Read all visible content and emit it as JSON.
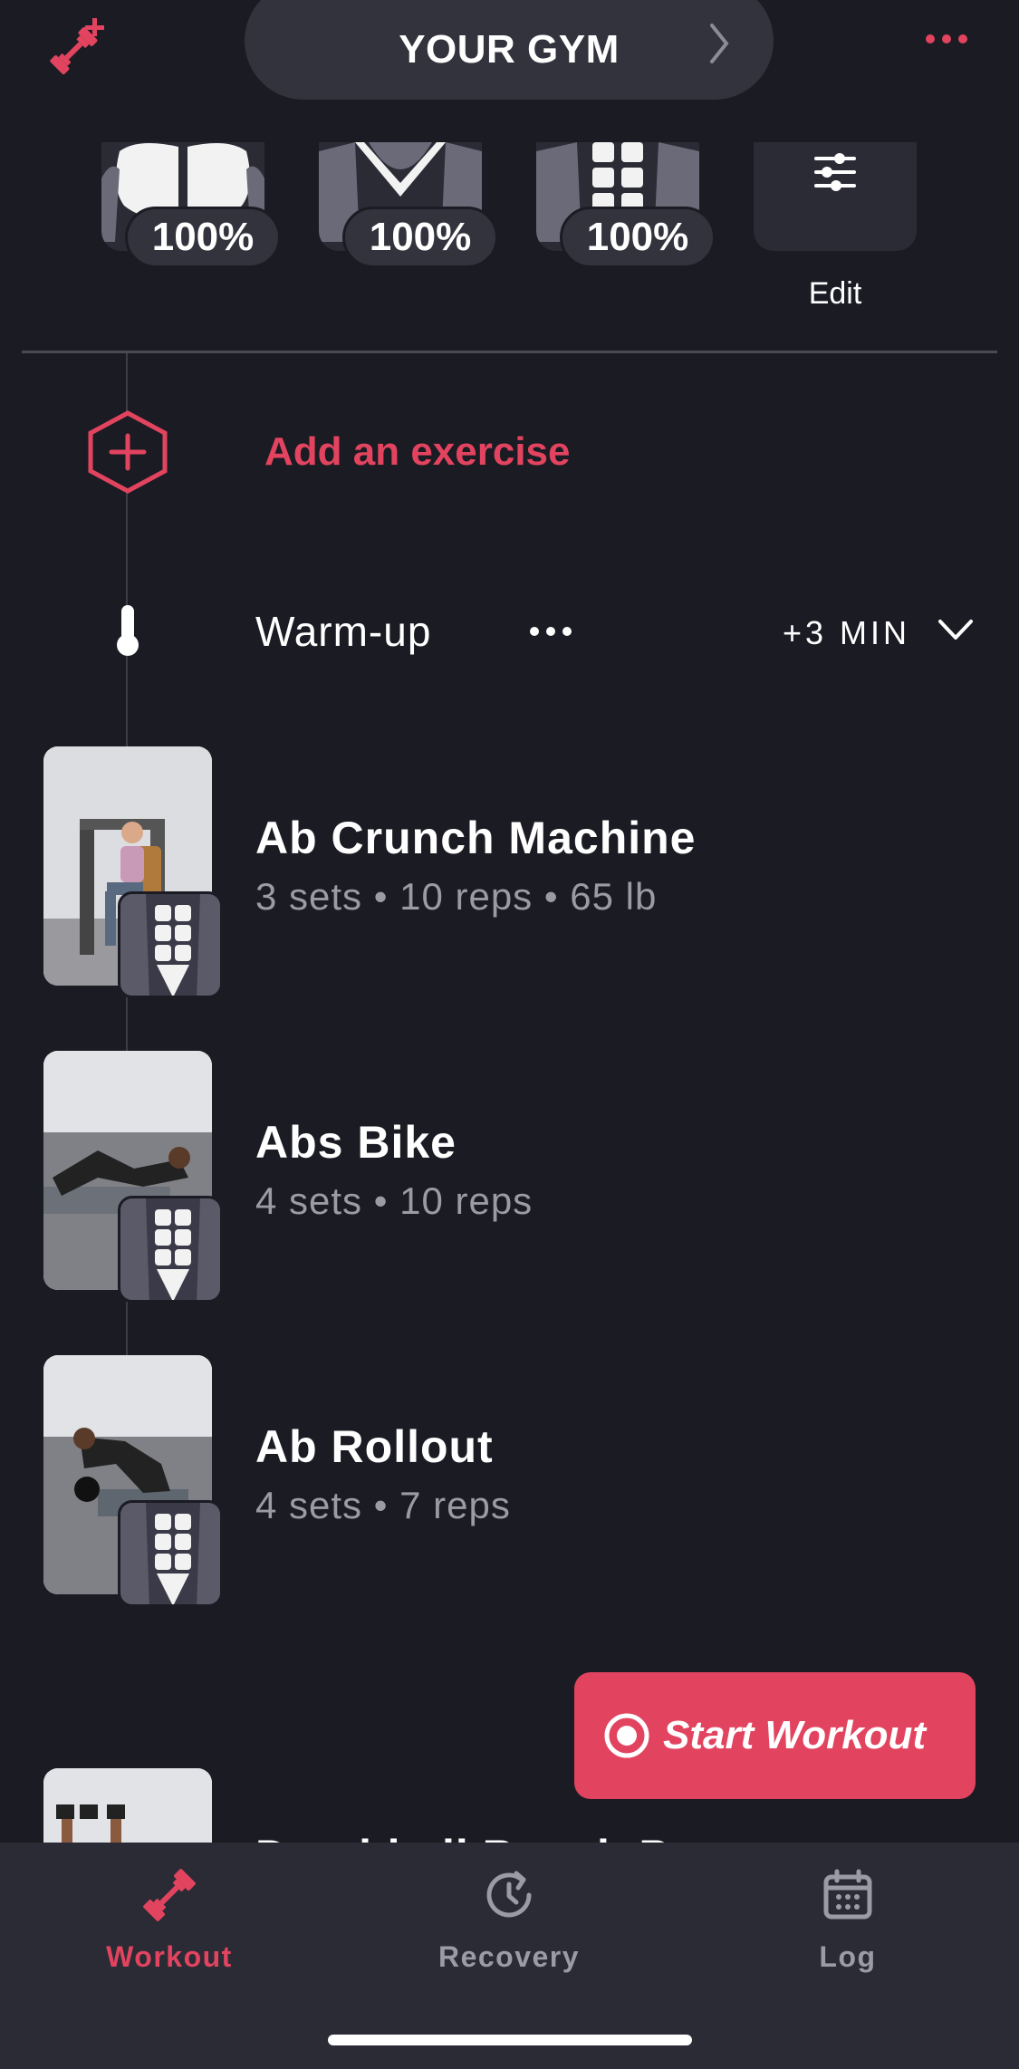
{
  "header": {
    "gym_title": "YOUR GYM"
  },
  "muscles": [
    {
      "name": "chest",
      "percent": "100%"
    },
    {
      "name": "back",
      "percent": "100%"
    },
    {
      "name": "abs",
      "percent": "100%"
    }
  ],
  "edit_label": "Edit",
  "add_exercise_label": "Add an exercise",
  "warmup": {
    "label": "Warm-up",
    "time": "+3 MIN"
  },
  "exercises": [
    {
      "name": "Ab Crunch Machine",
      "meta": "3 sets • 10 reps • 65 lb"
    },
    {
      "name": "Abs Bike",
      "meta": "4 sets • 10 reps"
    },
    {
      "name": "Ab Rollout",
      "meta": "4 sets • 7 reps"
    },
    {
      "name": "Dumbbell Bench Press",
      "meta": ""
    }
  ],
  "start_workout_label": "Start Workout",
  "tabs": [
    {
      "label": "Workout",
      "icon": "dumbbell-icon",
      "active": true
    },
    {
      "label": "Recovery",
      "icon": "recovery-clock-icon",
      "active": false
    },
    {
      "label": "Log",
      "icon": "calendar-icon",
      "active": false
    }
  ],
  "colors": {
    "accent": "#e2445f",
    "background": "#1b1b24",
    "surface": "#33333e",
    "muted_text": "#9b9ba6"
  }
}
